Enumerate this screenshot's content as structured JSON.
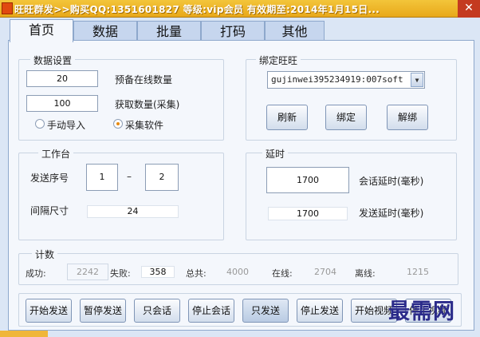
{
  "window": {
    "title": "旺旺群发>>购买QQ:1351601827   等级:vip会员    有效期至:2014年1月15日...",
    "close_glyph": "✕",
    "accent": "#e8a81a"
  },
  "tabs": [
    {
      "label": "首页"
    },
    {
      "label": "数据"
    },
    {
      "label": "批量"
    },
    {
      "label": "打码"
    },
    {
      "label": "其他"
    }
  ],
  "data_settings": {
    "title": "数据设置",
    "online_count_value": "20",
    "online_count_label": "预备在线数量",
    "fetch_count_value": "100",
    "fetch_count_label": "获取数量(采集)",
    "radio_manual_label": "手动导入",
    "radio_collect_label": "采集软件",
    "selected": "采集软件"
  },
  "bind": {
    "title": "绑定旺旺",
    "account_value": "gujinwei395234919:007soft",
    "refresh_label": "刷新",
    "bind_label": "绑定",
    "unbind_label": "解绑"
  },
  "workbench": {
    "title": "工作台",
    "seq_label": "发送序号",
    "seq_from": "1",
    "seq_dash": "–",
    "seq_to": "2",
    "interval_label": "间隔尺寸",
    "interval_value": "24"
  },
  "delay": {
    "title": "延时",
    "session_value": "1700",
    "session_label": "会话延时(毫秒)",
    "send_value": "1700",
    "send_label": "发送延时(毫秒)"
  },
  "counter": {
    "title": "计数",
    "success_label": "成功:",
    "success_value": "2242",
    "fail_label": "失败:",
    "fail_value": "358",
    "total_label": "总共:",
    "total_value": "4000",
    "online_label": "在线:",
    "online_value": "2704",
    "offline_label": "离线:",
    "offline_value": "1215"
  },
  "actions": {
    "start_send": "开始发送",
    "pause_send": "暂停发送",
    "session_only": "只会话",
    "stop_session": "停止会话",
    "send_only": "只发送",
    "stop_send": "停止发送",
    "start_video": "开始视频",
    "stop_video": "停止视频"
  },
  "watermark": "最需网"
}
